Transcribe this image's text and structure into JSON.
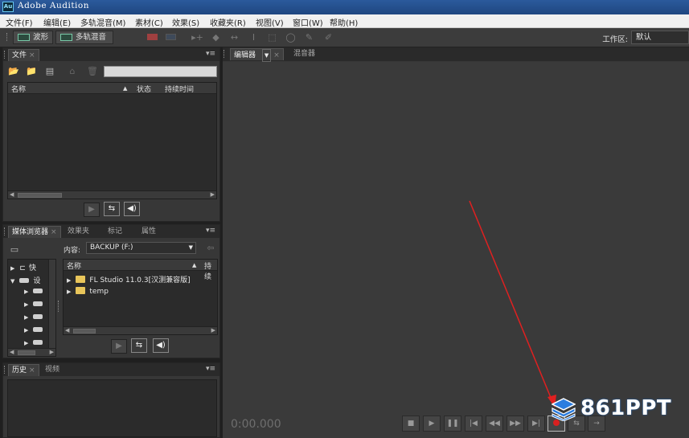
{
  "app": {
    "logo_text": "Au",
    "title": "Adobe Audition"
  },
  "menu": [
    "文件(F)",
    "编辑(E)",
    "多轨混音(M)",
    "素材(C)",
    "效果(S)",
    "收藏夹(R)",
    "视图(V)",
    "窗口(W)",
    "帮助(H)"
  ],
  "toolbar": {
    "waveform_label": "波形",
    "multitrack_label": "多轨混音",
    "workspace_label": "工作区:",
    "workspace_value": "默认"
  },
  "files_panel": {
    "tab": "文件",
    "columns": {
      "name": "名称",
      "status": "状态",
      "duration": "持续时间"
    },
    "search_placeholder": ""
  },
  "media_panel": {
    "tabs": [
      "媒体浏览器",
      "效果夹",
      "标记",
      "属性"
    ],
    "content_label": "内容:",
    "content_value": "BACKUP (F:)",
    "tree": [
      "快",
      "设"
    ],
    "columns": {
      "name": "名称",
      "duration": "持续"
    },
    "files": [
      "FL Studio 11.0.3[汉测兼容版]",
      "temp"
    ]
  },
  "history_panel": {
    "tabs": [
      "历史",
      "视频"
    ]
  },
  "editor": {
    "tabs": [
      "编辑器",
      "混音器"
    ],
    "timecode": "0:00.000",
    "record_color": "#d92020"
  },
  "watermark": {
    "text": "861PPT"
  },
  "colors": {
    "title_bar": "#2b5a9c",
    "panel_bg": "#373737",
    "arrow": "#e02020"
  }
}
